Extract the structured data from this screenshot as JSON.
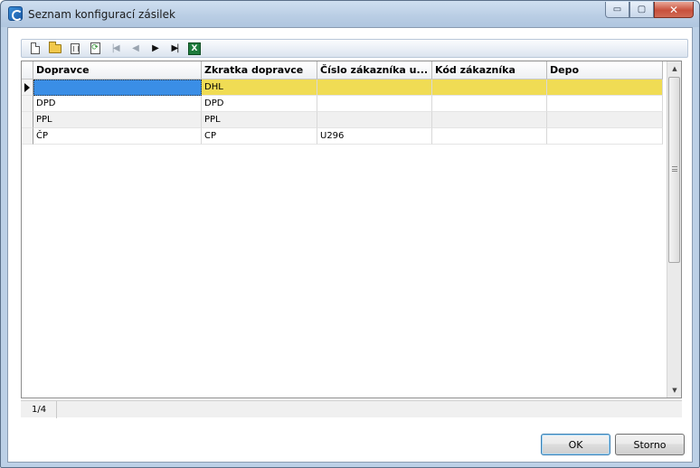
{
  "window": {
    "title": "Seznam konfigurací zásilek",
    "controls": {
      "minimize": "▭",
      "maximize": "▢",
      "close": "✕"
    }
  },
  "toolbar": {
    "buttons": [
      {
        "name": "new",
        "icon": "new-document-icon"
      },
      {
        "name": "open",
        "icon": "open-folder-icon"
      },
      {
        "name": "delete",
        "icon": "delete-icon"
      },
      {
        "name": "refresh",
        "icon": "refresh-icon"
      },
      {
        "name": "first",
        "icon": "first-record-icon",
        "glyph": "|◀",
        "enabled": false
      },
      {
        "name": "previous",
        "icon": "previous-record-icon",
        "glyph": "◀",
        "enabled": false
      },
      {
        "name": "next",
        "icon": "next-record-icon",
        "glyph": "▶",
        "enabled": true
      },
      {
        "name": "last",
        "icon": "last-record-icon",
        "glyph": "▶|",
        "enabled": true
      },
      {
        "name": "export",
        "icon": "excel-export-icon",
        "glyph": "X"
      }
    ]
  },
  "grid": {
    "columns": [
      "Dopravce",
      "Zkratka dopravce",
      "Číslo zákazníka u...",
      "Kód zákazníka",
      "Depo"
    ],
    "rows": [
      [
        "",
        "DHL",
        "",
        "",
        ""
      ],
      [
        "DPD",
        "DPD",
        "",
        "",
        ""
      ],
      [
        "PPL",
        "PPL",
        "",
        "",
        ""
      ],
      [
        "ČP",
        "CP",
        "U296",
        "",
        ""
      ]
    ],
    "selected_row": 0
  },
  "status": {
    "record_position": "1/4"
  },
  "buttons": {
    "ok": "OK",
    "cancel": "Storno"
  },
  "colors": {
    "selection_row": "#f0dc54",
    "current_cell": "#3a8ee6"
  }
}
